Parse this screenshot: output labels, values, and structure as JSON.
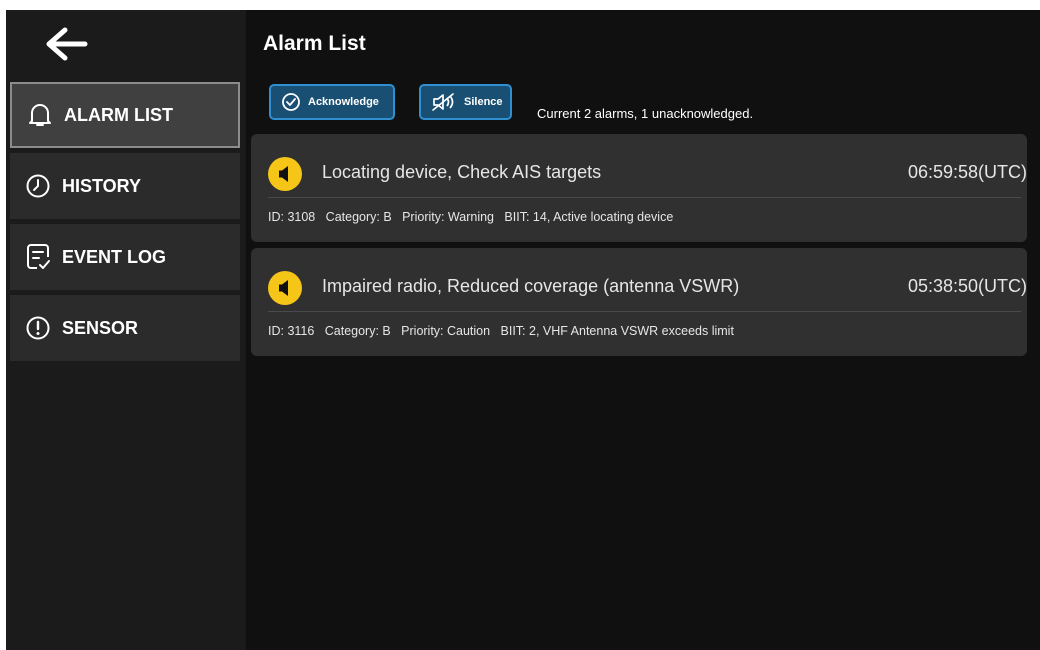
{
  "sidebar": {
    "items": [
      {
        "label": "ALARM LIST",
        "icon": "bell-icon"
      },
      {
        "label": "HISTORY",
        "icon": "clock-icon"
      },
      {
        "label": "EVENT LOG",
        "icon": "event-log-icon"
      },
      {
        "label": "SENSOR",
        "icon": "alert-circle-icon"
      }
    ]
  },
  "main": {
    "title": "Alarm List",
    "acknowledge_label": "Acknowledge",
    "silence_label": "Silence",
    "status": "Current 2 alarms, 1 unacknowledged."
  },
  "alarms": [
    {
      "message": "Locating device, Check AIS targets",
      "time": "06:59:58(UTC)",
      "meta": "ID: 3108   Category: B   Priority: Warning   BIIT: 14, Active locating device"
    },
    {
      "message": "Impaired radio, Reduced coverage (antenna VSWR)",
      "time": "05:38:50(UTC)",
      "meta": "ID: 3116   Category: B   Priority: Caution   BIIT: 2, VHF Antenna VSWR exceeds limit"
    }
  ],
  "colors": {
    "accent": "#2f8fd0",
    "alarm_icon": "#f5c518",
    "background": "#101010",
    "card": "#303030"
  }
}
